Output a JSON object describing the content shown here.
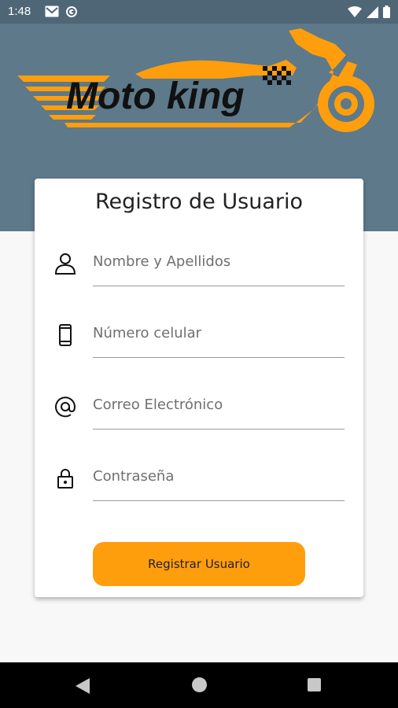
{
  "status_bar": {
    "time": "1:48",
    "icons": [
      "gmail-icon",
      "sync-icon",
      "wifi-icon",
      "signal-icon",
      "battery-icon"
    ]
  },
  "logo": {
    "text": "Moto king",
    "colors": {
      "orange": "#ff9e0d",
      "dark": "#111111"
    }
  },
  "card": {
    "title": "Registro de Usuario",
    "fields": [
      {
        "icon": "person-icon",
        "placeholder": "Nombre y Apellidos"
      },
      {
        "icon": "phone-icon",
        "placeholder": "Número celular"
      },
      {
        "icon": "at-icon",
        "placeholder": "Correo Electrónico"
      },
      {
        "icon": "lock-icon",
        "placeholder": "Contraseña"
      }
    ],
    "button_label": "Registrar Usuario"
  },
  "colors": {
    "header": "#5d798a",
    "accent": "#ff9e0d",
    "status": "#4e6676"
  }
}
